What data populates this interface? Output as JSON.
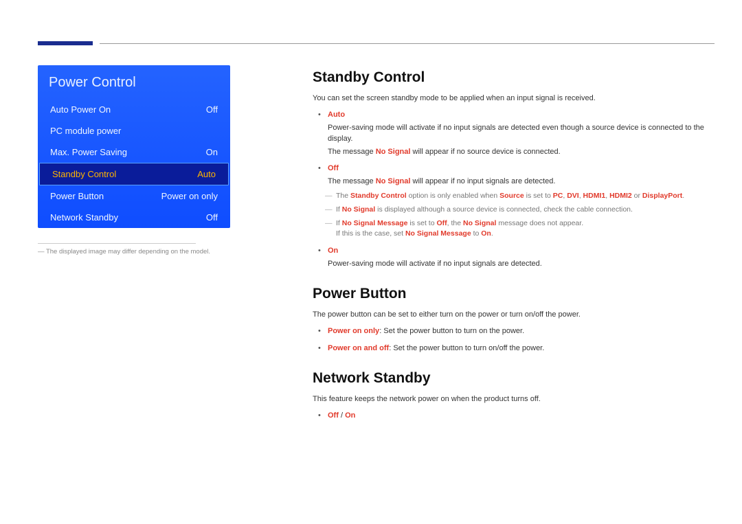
{
  "menu": {
    "title": "Power Control",
    "items": [
      {
        "label": "Auto Power On",
        "value": "Off",
        "selected": false
      },
      {
        "label": "PC module power",
        "value": "",
        "selected": false
      },
      {
        "label": "Max. Power Saving",
        "value": "On",
        "selected": false
      },
      {
        "label": "Standby Control",
        "value": "Auto",
        "selected": true
      },
      {
        "label": "Power Button",
        "value": "Power on only",
        "selected": false
      },
      {
        "label": "Network Standby",
        "value": "Off",
        "selected": false
      }
    ],
    "footnote_prefix": "― ",
    "footnote": "The displayed image may differ depending on the model."
  },
  "sections": {
    "standby": {
      "title": "Standby Control",
      "intro": "You can set the screen standby mode to be applied when an input signal is received.",
      "auto": {
        "label": "Auto",
        "line1_a": "Power-saving mode will activate if no input signals are detected even though a source device is connected to the display.",
        "line2_a": "The message ",
        "line2_b": "No Signal",
        "line2_c": " will appear if no source device is connected."
      },
      "off": {
        "label": "Off",
        "line1_a": "The message ",
        "line1_b": "No Signal",
        "line1_c": " will appear if no input signals are detected.",
        "note1_a": "The ",
        "note1_b": "Standby Control",
        "note1_c": " option is only enabled when ",
        "note1_d": "Source",
        "note1_e": " is set to ",
        "note1_f": "PC",
        "note1_g": ", ",
        "note1_h": "DVI",
        "note1_i": ", ",
        "note1_j": "HDMI1",
        "note1_k": ", ",
        "note1_l": "HDMI2",
        "note1_m": " or ",
        "note1_n": "DisplayPort",
        "note1_o": ".",
        "note2_a": "If ",
        "note2_b": "No Signal",
        "note2_c": " is displayed although a source device is connected, check the cable connection.",
        "note3_a": "If ",
        "note3_b": "No Signal Message",
        "note3_c": " is set to ",
        "note3_d": "Off",
        "note3_e": ", the ",
        "note3_f": "No Signal",
        "note3_g": " message does not appear.",
        "note3_line2_a": "If this is the case, set ",
        "note3_line2_b": "No Signal Message",
        "note3_line2_c": " to ",
        "note3_line2_d": "On",
        "note3_line2_e": "."
      },
      "on": {
        "label": "On",
        "line1": "Power-saving mode will activate if no input signals are detected."
      }
    },
    "powerbtn": {
      "title": "Power Button",
      "intro": "The power button can be set to either turn on the power or turn on/off the power.",
      "opt1_a": "Power on only",
      "opt1_b": ": Set the power button to turn on the power.",
      "opt2_a": "Power on and off",
      "opt2_b": ": Set the power button to turn on/off the power."
    },
    "netstandby": {
      "title": "Network Standby",
      "intro": "This feature keeps the network power on when the product turns off.",
      "opt_a": "Off",
      "opt_b": " / ",
      "opt_c": "On"
    }
  }
}
